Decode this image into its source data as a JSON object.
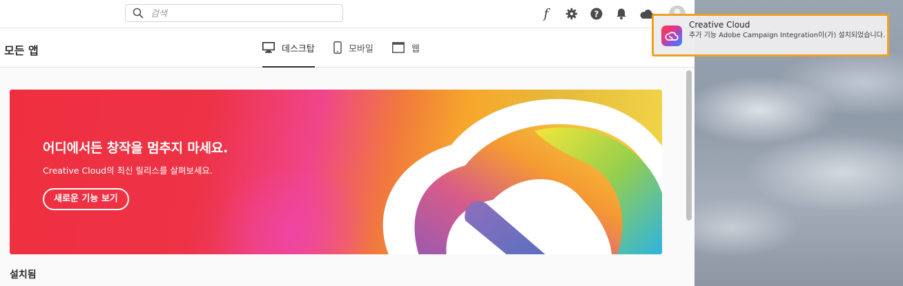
{
  "search": {
    "placeholder": "검색"
  },
  "toolbar": {
    "icons": [
      "fonts-icon",
      "gear-icon",
      "help-icon",
      "bell-icon",
      "cloud-icon",
      "avatar"
    ]
  },
  "nav": {
    "title": "모든 앱",
    "tabs": [
      {
        "label": "데스크탑",
        "icon": "desktop-icon",
        "active": true
      },
      {
        "label": "모바일",
        "icon": "mobile-icon",
        "active": false
      },
      {
        "label": "웹",
        "icon": "web-icon",
        "active": false
      }
    ]
  },
  "banner": {
    "title": "어디에서든 창작을 멈추지 마세요.",
    "subtitle": "Creative Cloud의 최신 릴리스를 살펴보세요.",
    "button_label": "새로운 기능 보기"
  },
  "sections": {
    "installed_label": "설치됨"
  },
  "notification": {
    "app_name": "Creative Cloud",
    "message": "추가 기능 Adobe Campaign Integration이(가) 설치되었습니다.",
    "highlight_color": "#f0a020"
  },
  "colors": {
    "banner_red": "#ee2f3f",
    "banner_yellow": "#f2d84a"
  }
}
